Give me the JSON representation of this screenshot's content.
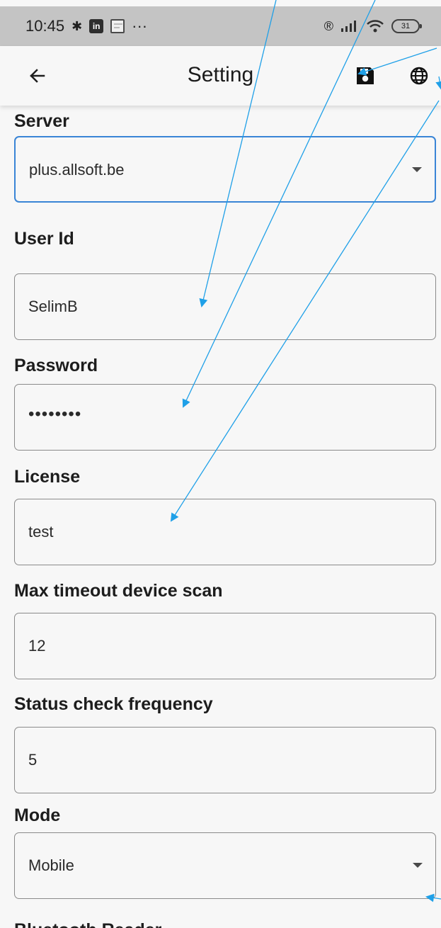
{
  "status_bar": {
    "time": "10:45",
    "more": "···",
    "battery": "31"
  },
  "app_bar": {
    "title": "Setting"
  },
  "fields": {
    "server": {
      "label": "Server",
      "value": "plus.allsoft.be"
    },
    "user_id": {
      "label": "User Id",
      "value": "SelimB"
    },
    "password": {
      "label": "Password",
      "value": "••••••••"
    },
    "license": {
      "label": "License",
      "value": "test"
    },
    "max_timeout": {
      "label": "Max timeout device scan",
      "value": "12"
    },
    "status_frequency": {
      "label": "Status check frequency",
      "value": "5"
    },
    "mode": {
      "label": "Mode",
      "value": "Mobile"
    },
    "bluetooth": {
      "label": "Bluetooth Reader"
    }
  },
  "colors": {
    "status_bar_bg": "#c4c4c4",
    "page_bg": "#f7f7f7",
    "focus_border": "#3a85d6",
    "annotation_line": "#1fa0e8"
  }
}
